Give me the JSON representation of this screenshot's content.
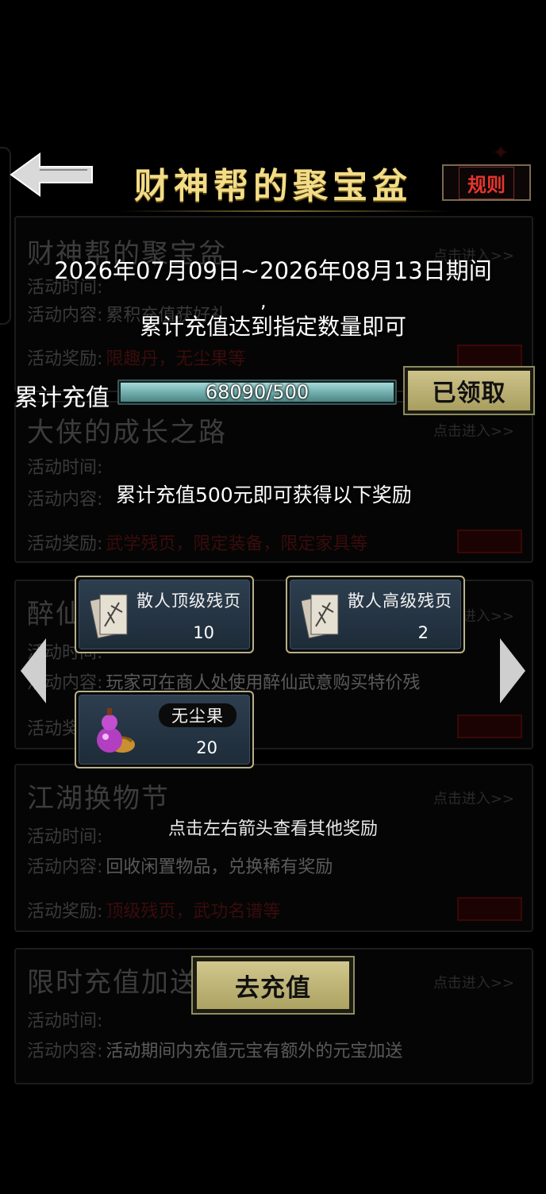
{
  "header": {
    "title": "财神帮的聚宝盆",
    "rules_label": "规则"
  },
  "background_activities": [
    {
      "title": "财神帮的聚宝盆",
      "enter": "点击进入>>",
      "rows": [
        {
          "key": "活动时间:",
          "value": ""
        },
        {
          "key": "活动内容:",
          "value": "累积充值获好礼"
        },
        {
          "key": "活动奖励:",
          "value": "限趣丹，无尘果等"
        }
      ]
    },
    {
      "title": "大侠的成长之路",
      "enter": "点击进入>>",
      "rows": [
        {
          "key": "活动时间:",
          "value": ""
        },
        {
          "key": "活动内容:",
          "value": ""
        },
        {
          "key": "活动奖励:",
          "value": "武学残页，限定装备，限定家具等"
        }
      ]
    },
    {
      "title": "醉仙",
      "enter": "点击进入>>",
      "rows": [
        {
          "key": "活动时间:",
          "value": ""
        },
        {
          "key": "活动内容:",
          "value": "玩家可在商人处使用醉仙武意购买特价残"
        },
        {
          "key": "活动奖励:",
          "value": ""
        }
      ]
    },
    {
      "title": "江湖换物节",
      "enter": "点击进入>>",
      "rows": [
        {
          "key": "活动时间:",
          "value": ""
        },
        {
          "key": "活动内容:",
          "value": "回收闲置物品，兑换稀有奖励"
        },
        {
          "key": "活动奖励:",
          "value": "顶级残页，武功名谱等"
        }
      ]
    },
    {
      "title": "限时充值加送",
      "enter": "点击进入>>",
      "rows": [
        {
          "key": "活动时间:",
          "value": ""
        },
        {
          "key": "活动内容:",
          "value": "活动期间内充值元宝有额外的元宝加送"
        }
      ]
    }
  ],
  "event": {
    "date_range": "2026年07月09日~2026年08月13日期间",
    "comma": ",",
    "requirement": "累计充值达到指定数量即可",
    "progress_label": "累计充值",
    "progress_text": "68090/500",
    "progress_fraction": 1.0,
    "claim_label": "已领取",
    "reward_desc": "累计充值500元即可获得以下奖励",
    "hint": "点击左右箭头查看其他奖励",
    "recharge_label": "去充值"
  },
  "rewards": [
    {
      "name": "散人顶级残页",
      "count": "10",
      "icon": "scroll-pages-icon"
    },
    {
      "name": "散人高级残页",
      "count": "2",
      "icon": "scroll-pages-icon"
    },
    {
      "name": "无尘果",
      "count": "20",
      "icon": "gourd-fruit-icon"
    }
  ],
  "colors": {
    "title_gold": "#f3dc86",
    "button_gold": "#cec38a",
    "progress_teal": "#8cc5c4",
    "rules_red": "#e5352d"
  }
}
